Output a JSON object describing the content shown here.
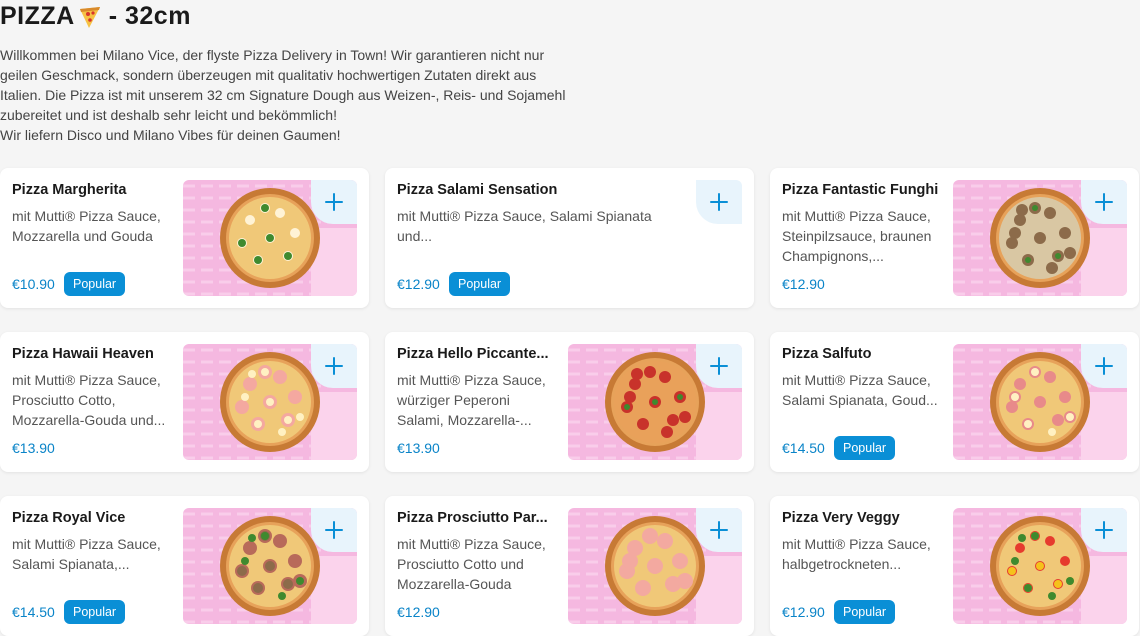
{
  "header": {
    "title_prefix": "PIZZA",
    "title_suffix": "- 32cm"
  },
  "intro": {
    "lines": [
      "Willkommen bei Milano Vice, der flyste Pizza Delivery in Town! Wir garantieren nicht nur",
      "geilen Geschmack, sondern überzeugen mit qualitativ hochwertigen Zutaten direkt aus",
      "Italien. Die Pizza ist mit unserem 32 cm Signature Dough aus Weizen-, Reis- und Sojamehl",
      "zubereitet und ist deshalb sehr leicht und bekömmlich!",
      "Wir liefern Disco und Milano Vibes für deinen Gaumen!"
    ]
  },
  "colors": {
    "accent": "#0a8fd6",
    "price": "#0a84c8",
    "image_bg": "#f5b8e0",
    "add_button_bg": "#e8f4fc"
  },
  "items": [
    {
      "name": "Pizza Margherita",
      "desc": "mit Mutti® Pizza Sauce, Mozzarella und Gouda",
      "price": "€10.90",
      "badge": "Popular",
      "topping": "margherita",
      "has_image": true
    },
    {
      "name": "Pizza Salami Sensation",
      "desc": "mit Mutti® Pizza Sauce, Salami Spianata und...",
      "price": "€12.90",
      "badge": "Popular",
      "topping": "none",
      "has_image": false
    },
    {
      "name": "Pizza Fantastic Funghi",
      "desc": "mit Mutti® Pizza Sauce, Steinpilzsauce, braunen Champignons,...",
      "price": "€12.90",
      "badge": "",
      "topping": "funghi",
      "has_image": true
    },
    {
      "name": "Pizza Hawaii Heaven",
      "desc": "mit Mutti® Pizza Sauce, Prosciutto Cotto, Mozzarella-Gouda und...",
      "price": "€13.90",
      "badge": "",
      "topping": "hawaii",
      "has_image": true
    },
    {
      "name": "Pizza Hello Piccante...",
      "desc": "mit Mutti® Pizza Sauce, würziger Peperoni Salami, Mozzarella-...",
      "price": "€13.90",
      "badge": "",
      "topping": "piccante",
      "has_image": true
    },
    {
      "name": "Pizza Salfuto",
      "desc": "mit Mutti® Pizza Sauce, Salami Spianata, Goud...",
      "price": "€14.50",
      "badge": "Popular",
      "topping": "salfuto",
      "has_image": true
    },
    {
      "name": "Pizza Royal Vice",
      "desc": "mit Mutti® Pizza Sauce, Salami Spianata,...",
      "price": "€14.50",
      "badge": "Popular",
      "topping": "royal",
      "has_image": true
    },
    {
      "name": "Pizza Prosciutto Par...",
      "desc": "mit Mutti® Pizza Sauce, Prosciutto Cotto und Mozzarella-Gouda",
      "price": "€12.90",
      "badge": "",
      "topping": "prosciutto",
      "has_image": true
    },
    {
      "name": "Pizza Very Veggy",
      "desc": "mit Mutti® Pizza Sauce, halbgetrockneten...",
      "price": "€12.90",
      "badge": "Popular",
      "topping": "veggy",
      "has_image": true
    }
  ]
}
